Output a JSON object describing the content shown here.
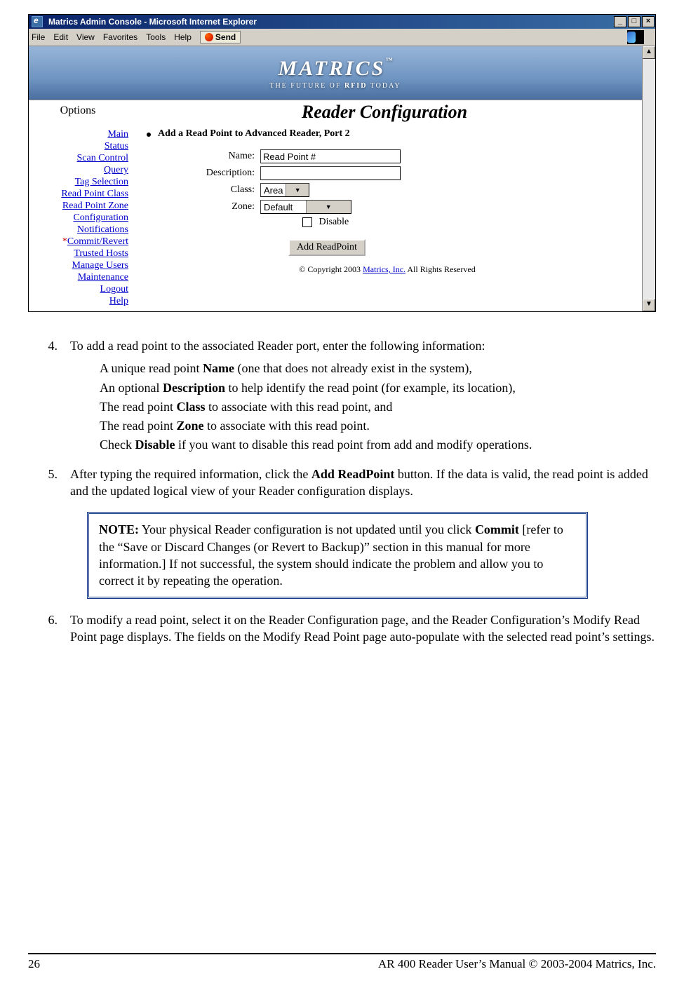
{
  "window": {
    "title": "Matrics Admin Console - Microsoft Internet Explorer",
    "min": "_",
    "max": "□",
    "close": "×",
    "menu": {
      "file": "File",
      "edit": "Edit",
      "view": "View",
      "favorites": "Favorites",
      "tools": "Tools",
      "help": "Help",
      "send": "Send"
    },
    "scroll_up": "▲",
    "scroll_down": "▼"
  },
  "banner": {
    "logo": "MATRICS",
    "tm": "™",
    "tagline_pre": "THE   FUTURE   OF ",
    "tagline_bold": "RFID",
    "tagline_post": "   TODAY"
  },
  "header": {
    "left": "Options",
    "right": "Reader Configuration"
  },
  "sidebar": {
    "items": [
      "Main",
      "Status",
      "Scan Control",
      "Query",
      "Tag Selection",
      "Read Point Class",
      "Read Point Zone",
      "Configuration",
      "Notifications",
      "Commit/Revert",
      "Trusted Hosts",
      "Manage Users",
      "Maintenance",
      "Logout",
      "Help"
    ],
    "star_index": 9,
    "star": "*"
  },
  "main": {
    "bullet": "Add a Read Point to Advanced Reader, Port 2",
    "labels": {
      "name": "Name:",
      "description": "Description:",
      "class": "Class:",
      "zone": "Zone:",
      "disable": "Disable"
    },
    "values": {
      "name": "Read Point #",
      "description": "",
      "class": "Area",
      "zone": "Default"
    },
    "button": "Add ReadPoint",
    "copyright_pre": "© Copyright 2003 ",
    "copyright_link": "Matrics, Inc.",
    "copyright_post": "  All Rights Reserved"
  },
  "doc": {
    "s4_intro": "To add a read point to the associated Reader port, enter the following information:",
    "s4_a_pre": "A unique read point ",
    "s4_a_b": "Name",
    "s4_a_post": " (one that does not already exist in the system),",
    "s4_b_pre": "An optional ",
    "s4_b_b": "Description",
    "s4_b_post": " to help identify the read point (for example, its location),",
    "s4_c_pre": "The read point ",
    "s4_c_b": "Class",
    "s4_c_post": " to associate with this read point, and",
    "s4_d_pre": "The read point ",
    "s4_d_b": "Zone",
    "s4_d_post": " to associate with this read point.",
    "s4_e_pre": "Check ",
    "s4_e_b": "Disable",
    "s4_e_post": " if you want to disable this read point from add and modify operations.",
    "s5_pre": "After typing the required information, click the ",
    "s5_b": "Add ReadPoint",
    "s5_post": " button. If the data is valid, the read point is added and the updated logical view of your Reader configuration displays.",
    "note_b1": "NOTE:",
    "note_t1": " Your physical Reader configuration is not updated until you click ",
    "note_b2": "Commit",
    "note_t2": " [refer to the “Save or Discard Changes (or Revert to Backup)” section in this manual for more information.] If not successful, the system should indicate the problem and allow you to correct it by repeating the operation.",
    "s6": "To modify a read point, select it on the Reader Configuration page, and the Reader Configuration’s Modify Read Point page displays. The fields on the Modify Read Point page auto-populate with the selected read point’s settings.",
    "n4": "4.",
    "n5": "5.",
    "n6": "6."
  },
  "footer": {
    "left": "26",
    "right": "AR 400 Reader User’s Manual © 2003-2004 Matrics, Inc."
  }
}
